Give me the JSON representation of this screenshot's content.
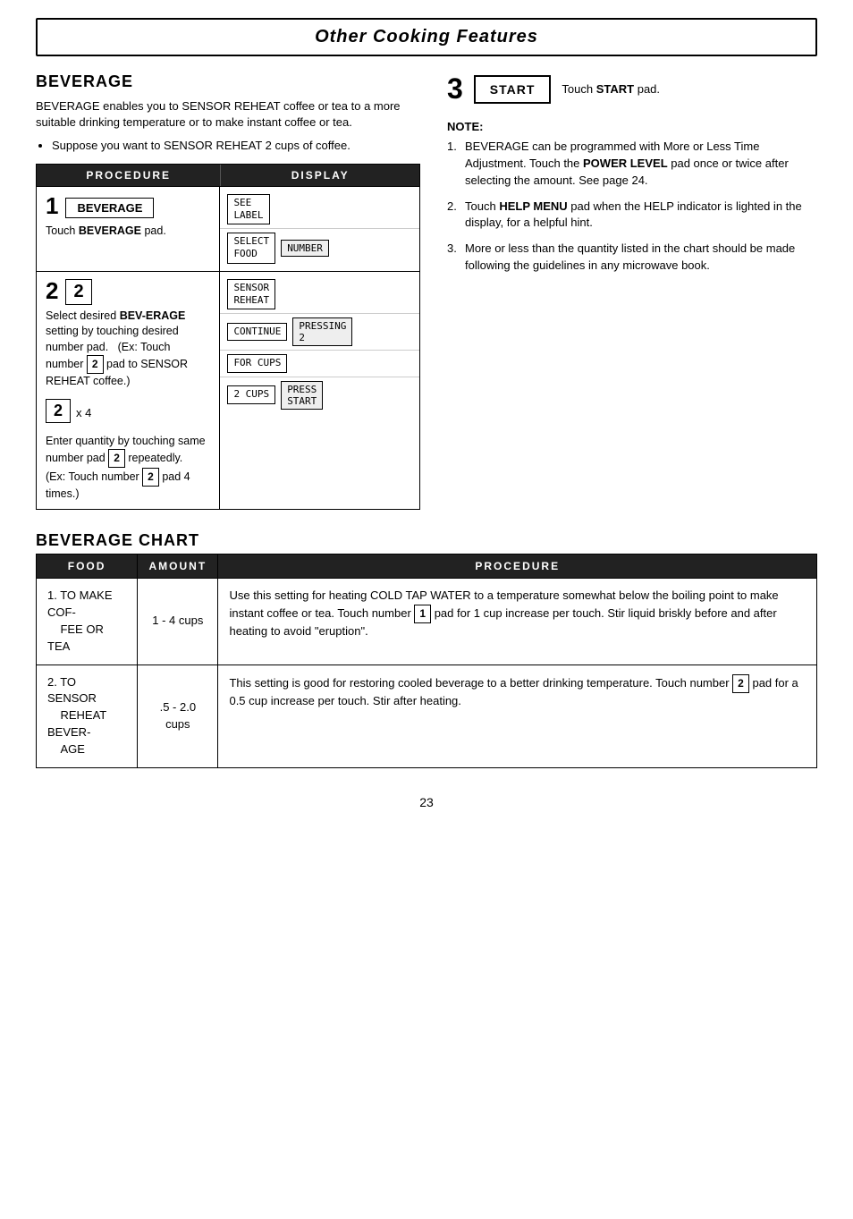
{
  "header": {
    "title": "Other Cooking Features"
  },
  "beverage_section": {
    "title": "BEVERAGE",
    "intro1": "BEVERAGE enables you to SENSOR REHEAT coffee or tea to a more suitable drinking temperature or to make instant coffee or tea.",
    "bullet1": "Suppose you want to SENSOR REHEAT 2 cups of coffee.",
    "procedure_header": "PROCEDURE",
    "display_header": "DISPLAY",
    "step1": {
      "number": "1",
      "label": "BEVERAGE",
      "instruction": "Touch BEVERAGE pad.",
      "display_rows": [
        {
          "box": "SEE\nLABEL",
          "right": ""
        },
        {
          "box": "SELECT\nFOOD",
          "right": "NUMBER"
        }
      ]
    },
    "step2": {
      "number": "2",
      "inner_num": "2",
      "instruction_bold": "BEV-ERAGE",
      "instruction": "Select desired BEV-ERAGE setting by touching desired number pad.    (Ex: Touch number",
      "num_pad_ref": "2",
      "instruction2": "pad to SENSOR REHEAT coffee.)",
      "x4_num": "2",
      "x4_label": "x 4",
      "enter_text": "Enter quantity by touching same number pad",
      "num2": "2",
      "repeatedly": " repeatedly.",
      "ex_text": "(Ex: Touch number",
      "num3": "2",
      "pad4times": " pad 4 times.)",
      "display_rows": [
        {
          "box": "SENSOR\nREHEAT",
          "right": ""
        },
        {
          "box": "CONTINUE",
          "right": "PRESSING\n2"
        },
        {
          "box": "FOR CUPS",
          "right": ""
        },
        {
          "box": "2 CUPS",
          "right": "PRESS\nSTART"
        }
      ]
    },
    "step3": {
      "number": "3",
      "button_label": "START",
      "text": "Touch START pad."
    }
  },
  "note_section": {
    "title": "NOTE:",
    "notes": [
      "BEVERAGE can be programmed with More or Less Time Adjustment. Touch the POWER LEVEL pad once or twice after selecting the amount. See page 24.",
      "Touch HELP MENU pad when the HELP indicator is lighted in the display, for a helpful hint.",
      "More or less than the quantity listed in the chart should be made following the guidelines in any microwave book."
    ]
  },
  "chart_section": {
    "title": "BEVERAGE CHART",
    "headers": [
      "FOOD",
      "AMOUNT",
      "PROCEDURE"
    ],
    "rows": [
      {
        "food": "1. TO MAKE COF-\n    FEE OR TEA",
        "amount": "1  - 4 cups",
        "procedure": "Use this setting for heating COLD TAP WATER to a temperature somewhat below the boiling point to make instant coffee or tea. Touch number [1] pad for 1 cup increase per touch. Stir liquid briskly before and after heating to avoid \"eruption\"."
      },
      {
        "food": "2. TO SENSOR\n    REHEAT BEVER-\n    AGE",
        "amount": ".5  - 2.0 cups",
        "procedure": "This setting is good for restoring cooled beverage to a better drinking temperature. Touch number [2] pad for a 0.5 cup increase per touch. Stir after heating."
      }
    ]
  },
  "page_number": "23"
}
